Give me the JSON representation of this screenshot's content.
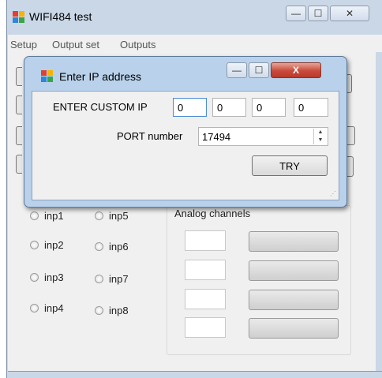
{
  "main_window": {
    "title": "WIFI484 test",
    "menu": [
      "Setup",
      "Output set",
      "Outputs"
    ],
    "caption_buttons": {
      "minimize": "—",
      "maximize": "☐",
      "close": "✕"
    }
  },
  "inputs": {
    "left": [
      "inp1",
      "inp2",
      "inp3",
      "inp4"
    ],
    "right": [
      "inp5",
      "inp6",
      "inp7",
      "inp8"
    ]
  },
  "analog": {
    "label": "Analog channels",
    "fields": [
      "",
      "",
      "",
      ""
    ]
  },
  "dialog": {
    "title": "Enter IP address",
    "custom_ip_label": "ENTER CUSTOM IP",
    "ip_octets": [
      "0",
      "0",
      "0",
      "0"
    ],
    "port_label": "PORT number",
    "port_value": "17494",
    "try_label": "TRY",
    "caption_buttons": {
      "minimize": "—",
      "maximize": "☐",
      "close": "X"
    }
  },
  "colors": {
    "window_frame": "#c9d7e7",
    "dialog_frame": "#b9d1ea",
    "close_button": "#c9493a",
    "client_bg": "#f0f0f0"
  }
}
